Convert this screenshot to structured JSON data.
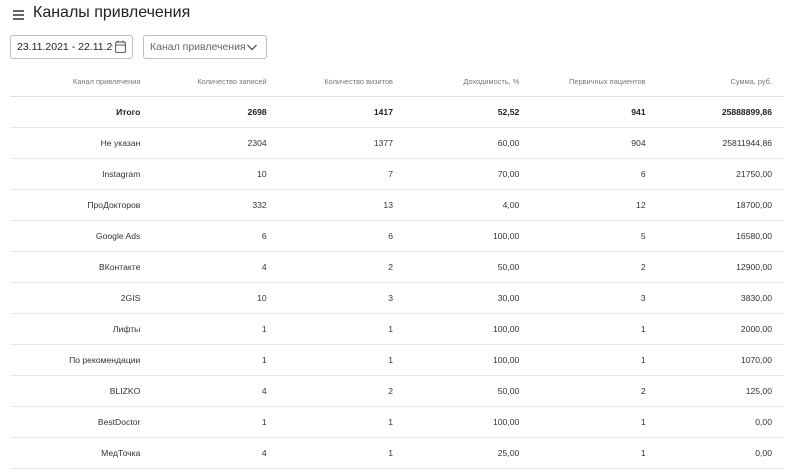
{
  "header": {
    "title": "Каналы привлечения",
    "menu_icon": "menu-icon"
  },
  "filters": {
    "date_range": "23.11.2021 - 22.11.2022",
    "calendar_icon": "calendar-icon",
    "channel_placeholder": "Канал привлечения",
    "chevron_icon": "chevron-down-icon"
  },
  "table": {
    "columns": [
      "Канал привлечения",
      "Количество записей",
      "Количество визитов",
      "Доходимость, %",
      "Первичных пациентов",
      "Сумма, руб."
    ],
    "total": [
      "Итого",
      "2698",
      "1417",
      "52,52",
      "941",
      "25888899,86"
    ],
    "rows": [
      [
        "Не указан",
        "2304",
        "1377",
        "60,00",
        "904",
        "25811944,86"
      ],
      [
        "Instagram",
        "10",
        "7",
        "70,00",
        "6",
        "21750,00"
      ],
      [
        "ПроДокторов",
        "332",
        "13",
        "4,00",
        "12",
        "18700,00"
      ],
      [
        "Google Ads",
        "6",
        "6",
        "100,00",
        "5",
        "16580,00"
      ],
      [
        "ВКонтакте",
        "4",
        "2",
        "50,00",
        "2",
        "12900,00"
      ],
      [
        "2GIS",
        "10",
        "3",
        "30,00",
        "3",
        "3830,00"
      ],
      [
        "Лифты",
        "1",
        "1",
        "100,00",
        "1",
        "2000,00"
      ],
      [
        "По рекомендации",
        "1",
        "1",
        "100,00",
        "1",
        "1070,00"
      ],
      [
        "BLIZKO",
        "4",
        "2",
        "50,00",
        "2",
        "125,00"
      ],
      [
        "BestDoctor",
        "1",
        "1",
        "100,00",
        "1",
        "0,00"
      ],
      [
        "МедТочка",
        "4",
        "1",
        "25,00",
        "1",
        "0,00"
      ]
    ]
  },
  "colors": {
    "border": "#bdbdbd",
    "row_divider": "#e6e6e6",
    "header_text": "#777777",
    "text": "#333333"
  }
}
